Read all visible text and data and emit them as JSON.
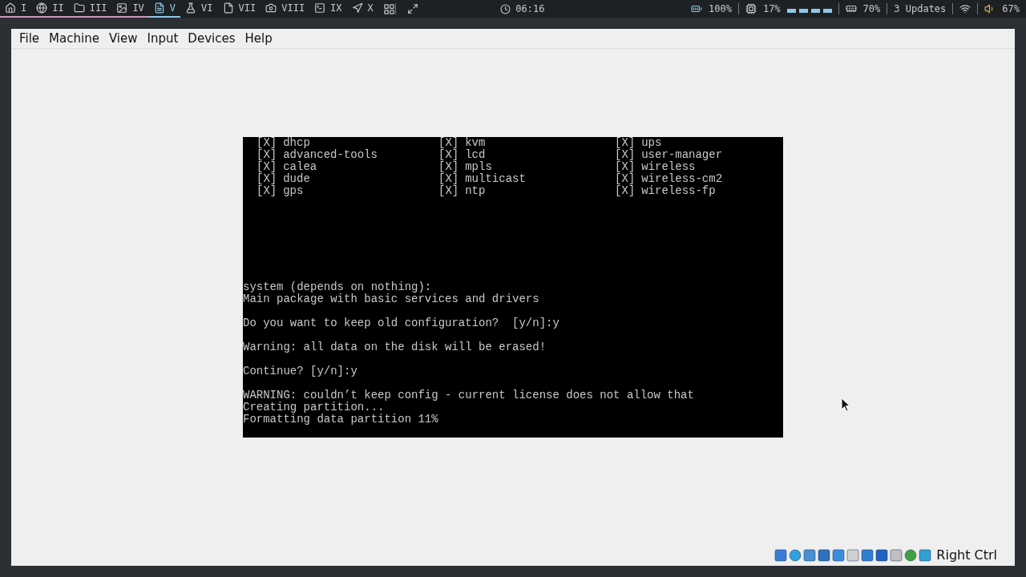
{
  "workspaces": [
    {
      "label": "I",
      "selected": false,
      "occupied": true
    },
    {
      "label": "II",
      "selected": false,
      "occupied": true
    },
    {
      "label": "III",
      "selected": false,
      "occupied": true
    },
    {
      "label": "IV",
      "selected": false,
      "occupied": true
    },
    {
      "label": "V",
      "selected": true,
      "occupied": false
    },
    {
      "label": "VI",
      "selected": false,
      "occupied": false
    },
    {
      "label": "VII",
      "selected": false,
      "occupied": false
    },
    {
      "label": "VIII",
      "selected": false,
      "occupied": false
    },
    {
      "label": "IX",
      "selected": false,
      "occupied": false
    },
    {
      "label": "X",
      "selected": false,
      "occupied": false
    }
  ],
  "clock": "06:16",
  "status": {
    "battery": "100%",
    "cpu": "17%",
    "memory": "70%",
    "updates": "3 Updates",
    "volume": "67%"
  },
  "menu": [
    "File",
    "Machine",
    "View",
    "Input",
    "Devices",
    "Help"
  ],
  "packages": [
    {
      "mark": "[X]",
      "name": "dhcp"
    },
    {
      "mark": "[X]",
      "name": "advanced-tools"
    },
    {
      "mark": "[X]",
      "name": "calea"
    },
    {
      "mark": "[X]",
      "name": "dude"
    },
    {
      "mark": "[X]",
      "name": "gps"
    },
    {
      "mark": "[X]",
      "name": "kvm"
    },
    {
      "mark": "[X]",
      "name": "lcd"
    },
    {
      "mark": "[X]",
      "name": "mpls"
    },
    {
      "mark": "[X]",
      "name": "multicast"
    },
    {
      "mark": "[X]",
      "name": "ntp"
    },
    {
      "mark": "[X]",
      "name": "ups"
    },
    {
      "mark": "[X]",
      "name": "user-manager"
    },
    {
      "mark": "[X]",
      "name": "wireless"
    },
    {
      "mark": "[X]",
      "name": "wireless-cm2"
    },
    {
      "mark": "[X]",
      "name": "wireless-fp"
    }
  ],
  "console": [
    [
      "system (depends on nothing):",
      "Main package with basic services and drivers"
    ],
    [
      "Do you want to keep old configuration?  [y/n]:y"
    ],
    [
      "Warning: all data on the disk will be erased!"
    ],
    [
      "Continue? [y/n]:y"
    ],
    [
      "WARNING: couldn’t keep config - current license does not allow that",
      "Creating partition...",
      "Formatting data partition 11%"
    ]
  ],
  "host_key": "Right Ctrl"
}
